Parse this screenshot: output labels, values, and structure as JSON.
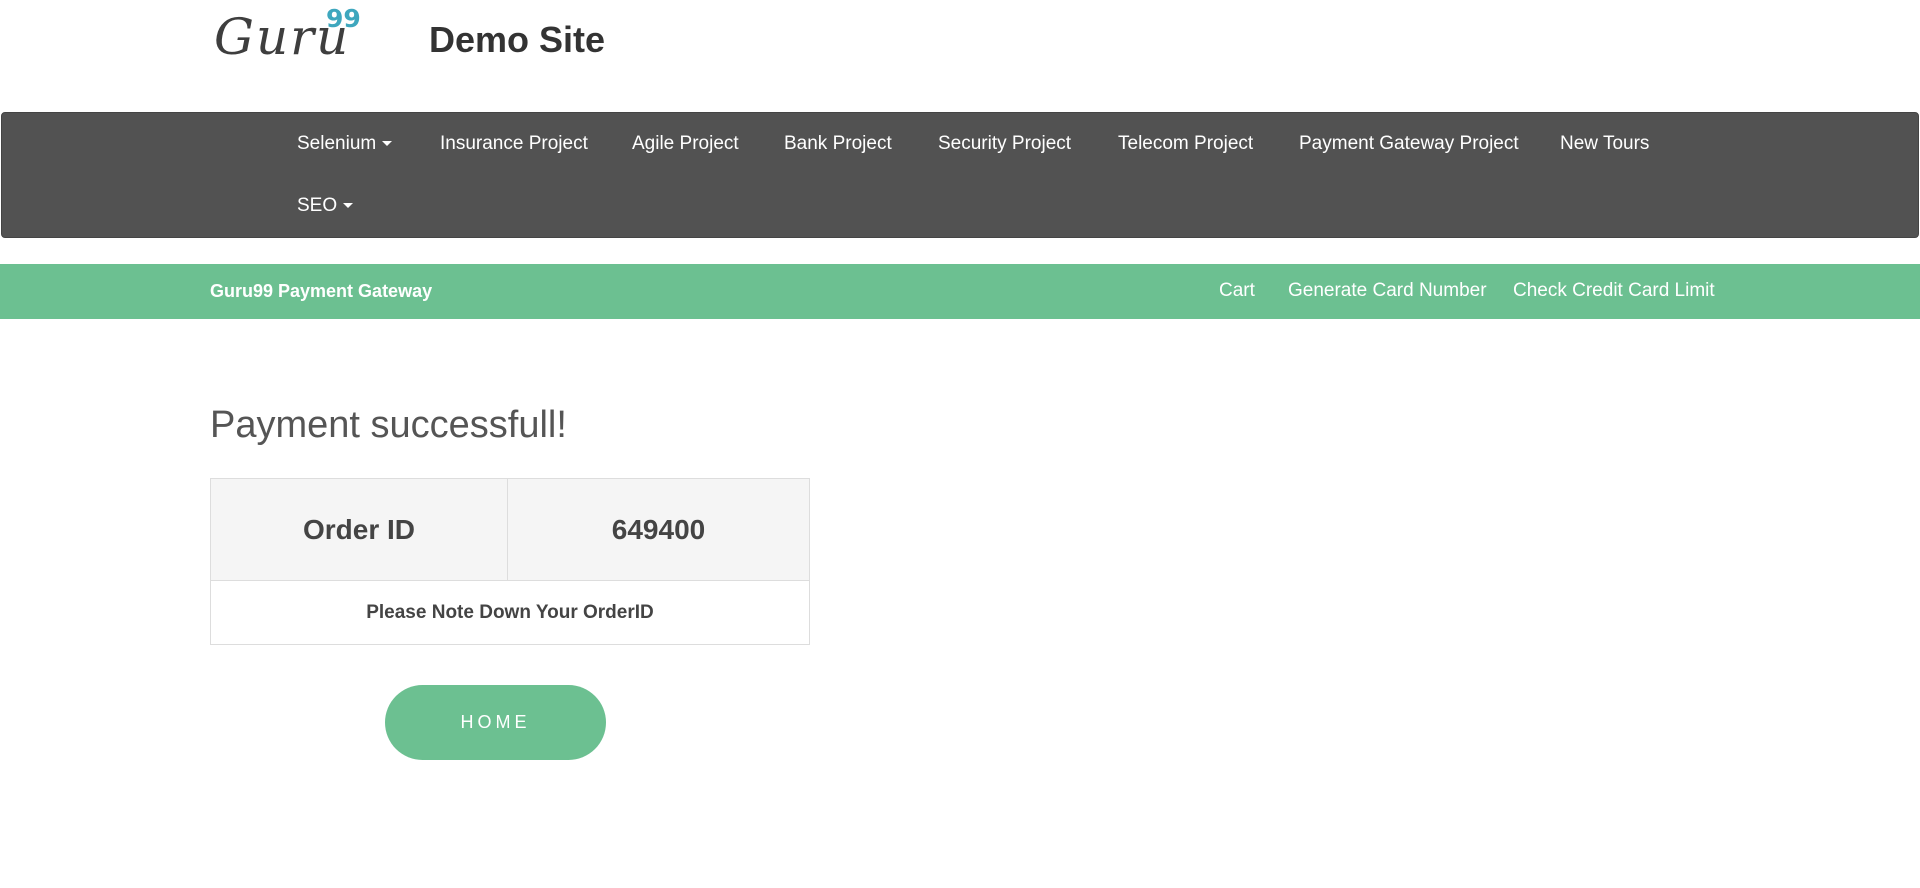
{
  "header": {
    "logo_text": "Guru",
    "logo_sup": "99",
    "site_title": "Demo Site"
  },
  "topnav": {
    "items": [
      {
        "label": "Selenium",
        "dropdown": true
      },
      {
        "label": "Insurance Project",
        "dropdown": false
      },
      {
        "label": "Agile Project",
        "dropdown": false
      },
      {
        "label": "Bank Project",
        "dropdown": false
      },
      {
        "label": "Security Project",
        "dropdown": false
      },
      {
        "label": "Telecom Project",
        "dropdown": false
      },
      {
        "label": "Payment Gateway Project",
        "dropdown": false
      },
      {
        "label": "New Tours",
        "dropdown": false
      },
      {
        "label": "SEO",
        "dropdown": true
      }
    ]
  },
  "subbar": {
    "brand": "Guru99 Payment Gateway",
    "links": [
      "Cart",
      "Generate Card Number",
      "Check Credit Card Limit"
    ]
  },
  "main": {
    "heading": "Payment successfull!",
    "order_label": "Order ID",
    "order_id": "649400",
    "note": "Please Note Down Your OrderID",
    "home_button": "HOME"
  },
  "colors": {
    "nav_bg": "#525252",
    "accent_green": "#6cc091",
    "logo_sup": "#3ea7be"
  }
}
